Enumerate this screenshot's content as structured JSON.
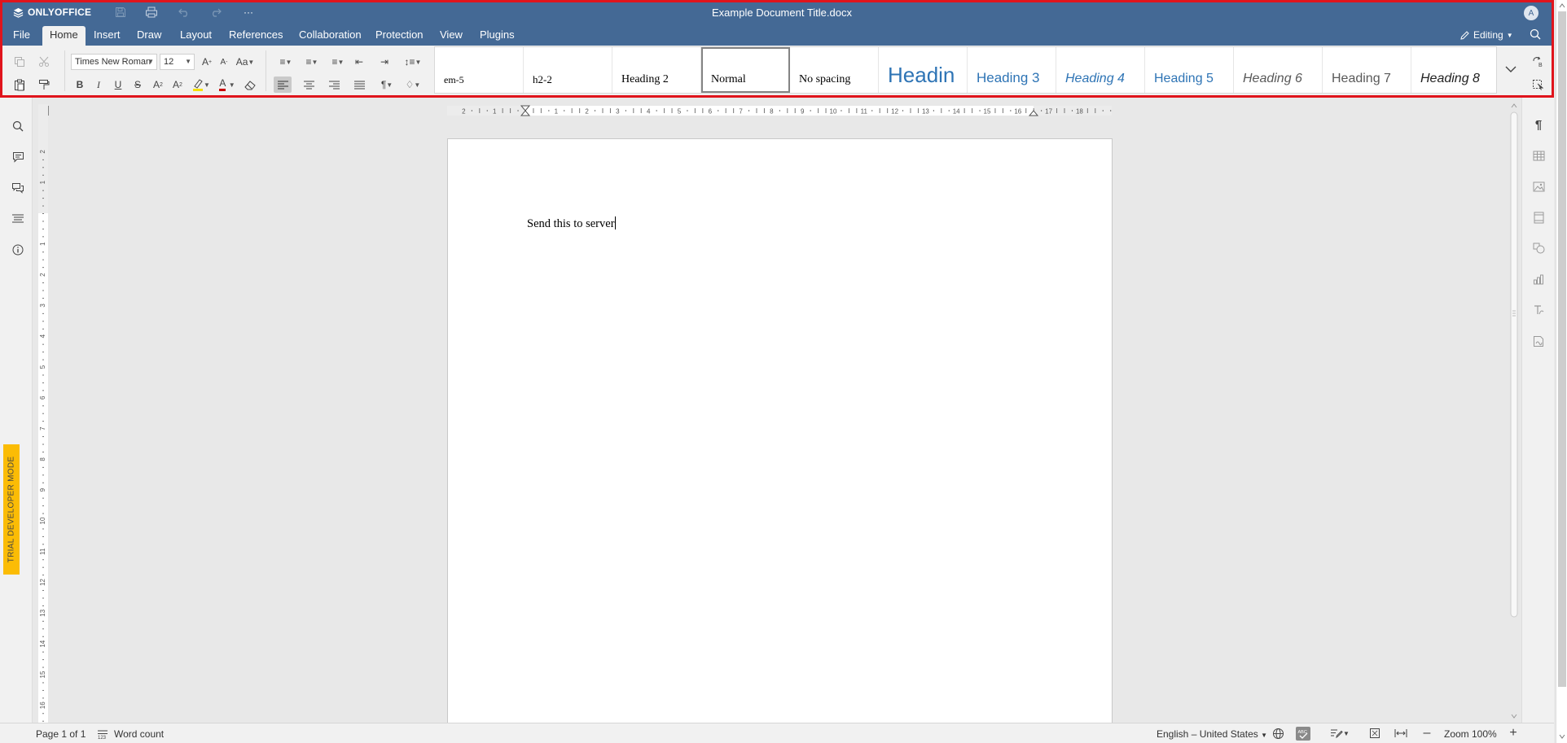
{
  "app": {
    "logo_text": "ONLYOFFICE",
    "doc_title": "Example Document Title.docx",
    "avatar_initial": "A",
    "mode_label": "Editing"
  },
  "menu_tabs": [
    "File",
    "Home",
    "Insert",
    "Draw",
    "Layout",
    "References",
    "Collaboration",
    "Protection",
    "View",
    "Plugins"
  ],
  "active_tab": "Home",
  "toolbar": {
    "font_name": "Times New Roman",
    "font_size": "12"
  },
  "styles": [
    "em-5",
    "h2-2",
    "Heading 2",
    "Normal",
    "No spacing",
    "Headin",
    "Heading 3",
    "Heading 4",
    "Heading 5",
    "Heading 6",
    "Heading 7",
    "Heading 8"
  ],
  "selected_style": "Normal",
  "ruler": {
    "h_labels": [
      "2",
      "1",
      "1",
      "2",
      "3",
      "4",
      "5",
      "6",
      "7",
      "8",
      "9",
      "10",
      "11",
      "12",
      "13",
      "14",
      "15",
      "16",
      "17",
      "18"
    ],
    "v_labels": [
      "2",
      "1",
      "1",
      "2",
      "3",
      "4",
      "5",
      "6",
      "7",
      "8",
      "9",
      "10",
      "11",
      "12",
      "13",
      "14",
      "15",
      "16"
    ]
  },
  "trial_banner": "TRIAL DEVELOPER MODE",
  "document": {
    "text": "Send this to server"
  },
  "statusbar": {
    "page_info": "Page 1 of 1",
    "word_count": "Word count",
    "language": "English – United States",
    "zoom": "Zoom 100%"
  },
  "colors": {
    "header": "#446995",
    "highlight_border": "#e0141c",
    "trial": "#fbbc05",
    "highlight_bar": "#f5e10a",
    "font_color_bar": "#c80000"
  }
}
